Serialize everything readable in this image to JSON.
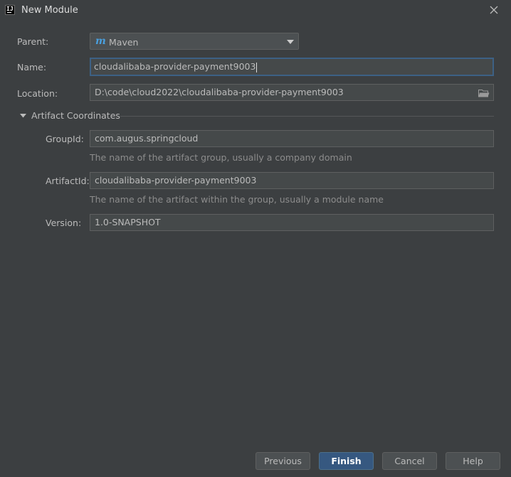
{
  "window": {
    "title": "New Module",
    "app_icon_text": "IJ",
    "app_icon": "intellij-icon",
    "close_icon": "close-icon"
  },
  "form": {
    "parent": {
      "label": "Parent:",
      "value": "Maven",
      "icon": "maven-icon",
      "icon_text": "m"
    },
    "name": {
      "label": "Name:",
      "value": "cloudalibaba-provider-payment9003"
    },
    "location": {
      "label": "Location:",
      "value": "D:\\code\\cloud2022\\cloudalibaba-provider-payment9003",
      "icon": "folder-icon"
    }
  },
  "artifact": {
    "section_title": "Artifact Coordinates",
    "expanded": true,
    "group_id": {
      "label": "GroupId:",
      "value": "com.augus.springcloud",
      "hint": "The name of the artifact group, usually a company domain"
    },
    "artifact_id": {
      "label": "ArtifactId:",
      "value": "cloudalibaba-provider-payment9003",
      "hint": "The name of the artifact within the group, usually a module name"
    },
    "version": {
      "label": "Version:",
      "value": "1.0-SNAPSHOT"
    }
  },
  "buttons": {
    "previous": "Previous",
    "finish": "Finish",
    "cancel": "Cancel",
    "help": "Help"
  },
  "colors": {
    "background": "#3c3f41",
    "field": "#45494a",
    "focus_border": "#3d6185",
    "primary_button": "#365880",
    "maven_icon": "#4a9fdd"
  }
}
